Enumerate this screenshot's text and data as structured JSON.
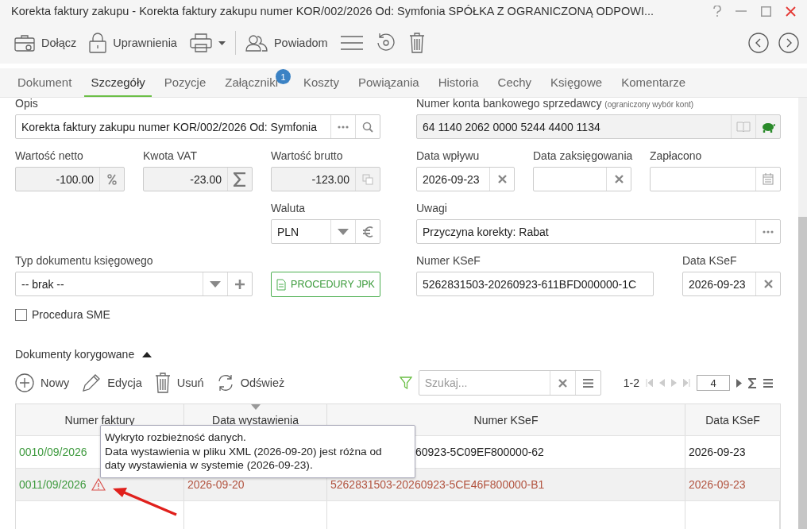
{
  "window": {
    "title": "Korekta faktury zakupu - Korekta faktury zakupu numer KOR/002/2026 Od: Symfonia SPÓŁKA Z OGRANICZONĄ ODPOWI..."
  },
  "toolbar": [
    {
      "kind": "attach",
      "label": "Dołącz"
    },
    {
      "kind": "lock",
      "label": "Uprawnienia"
    },
    {
      "kind": "print"
    },
    {
      "kind": "notify",
      "label": "Powiadom"
    },
    {
      "kind": "menu"
    },
    {
      "kind": "restore"
    },
    {
      "kind": "delete"
    }
  ],
  "tabs": [
    {
      "label": "Dokument",
      "selected": false
    },
    {
      "label": "Szczegóły",
      "selected": true
    },
    {
      "label": "Pozycje",
      "selected": false
    },
    {
      "label": "Załączniki",
      "selected": false,
      "badge": "1"
    },
    {
      "label": "Koszty",
      "selected": false
    },
    {
      "label": "Powiązania",
      "selected": false
    },
    {
      "label": "Historia",
      "selected": false
    },
    {
      "label": "Cechy",
      "selected": false
    },
    {
      "label": "Księgowe",
      "selected": false
    },
    {
      "label": "Komentarze",
      "selected": false
    }
  ],
  "form": {
    "opis": {
      "label": "Opis",
      "value": "Korekta faktury zakupu numer KOR/002/2026 Od: Symfonia",
      "readonly": false
    },
    "konto": {
      "label": "Numer konta bankowego sprzedawcy",
      "hint": "(ograniczony wybór kont)",
      "value": "64 1140 2062 0000 5244 4400 1134",
      "readonly": true
    },
    "netto": {
      "label": "Wartość netto",
      "value": "-100.00",
      "readonly": true
    },
    "vat": {
      "label": "Kwota VAT",
      "value": "-23.00",
      "readonly": true
    },
    "brutto": {
      "label": "Wartość brutto",
      "value": "-123.00",
      "readonly": true
    },
    "data_wplywu": {
      "label": "Data wpływu",
      "value": "2026-09-23",
      "readonly": false
    },
    "data_zaksiegowania": {
      "label": "Data zaksięgowania",
      "readonly": false
    },
    "zaplacono": {
      "label": "Zapłacono",
      "readonly": false
    },
    "waluta": {
      "label": "Waluta",
      "value": "PLN",
      "readonly": false
    },
    "uwagi": {
      "label": "Uwagi",
      "value": "Przyczyna korekty: Rabat",
      "readonly": false
    },
    "typ": {
      "label": "Typ dokumentu księgowego",
      "value": "-- brak --",
      "readonly": false
    },
    "jpk_button": "PROCEDURY JPK",
    "numer_ksef": {
      "label": "Numer KSeF",
      "value": "5262831503-20260923-611BFD000000-1C",
      "readonly": false
    },
    "data_ksef": {
      "label": "Data KSeF",
      "value": "2026-09-23",
      "readonly": false
    },
    "sme": {
      "label": "Procedura SME",
      "checked": false
    }
  },
  "section": {
    "title": "Dokumenty korygowane",
    "expanded": true,
    "actions": [
      {
        "kind": "new",
        "label": "Nowy"
      },
      {
        "kind": "edit",
        "label": "Edycja"
      },
      {
        "kind": "delete",
        "label": "Usuń"
      },
      {
        "kind": "refresh",
        "label": "Odśwież"
      }
    ],
    "search": {
      "placeholder": "Szukaj..."
    },
    "pager": {
      "range": "1-2",
      "page_size": "4"
    },
    "columns": [
      {
        "label": "Numer faktury",
        "sorted": false
      },
      {
        "label": "Data wystawienia",
        "sorted": true
      },
      {
        "label": "Numer KSeF",
        "sorted": false
      },
      {
        "label": "Data KSeF",
        "sorted": false
      }
    ],
    "rows": [
      {
        "numer_faktury": "0010/09/2026",
        "numer_ksef": "60923-5C09EF800000-62",
        "data_ksef": "2026-09-23",
        "mismatch": false,
        "selected": false
      },
      {
        "numer_faktury": "0011/09/2026",
        "data_wystawienia": "2026-09-20",
        "numer_ksef": "5262831503-20260923-5CE46F800000-B1",
        "data_ksef": "2026-09-23",
        "mismatch": true,
        "selected": true
      }
    ],
    "tooltip": {
      "title": "Wykryto rozbieżność danych.",
      "text": "Data wystawienia w pliku XML (2026-09-20) jest różna od daty wystawienia w systemie (2026-09-23)."
    }
  }
}
